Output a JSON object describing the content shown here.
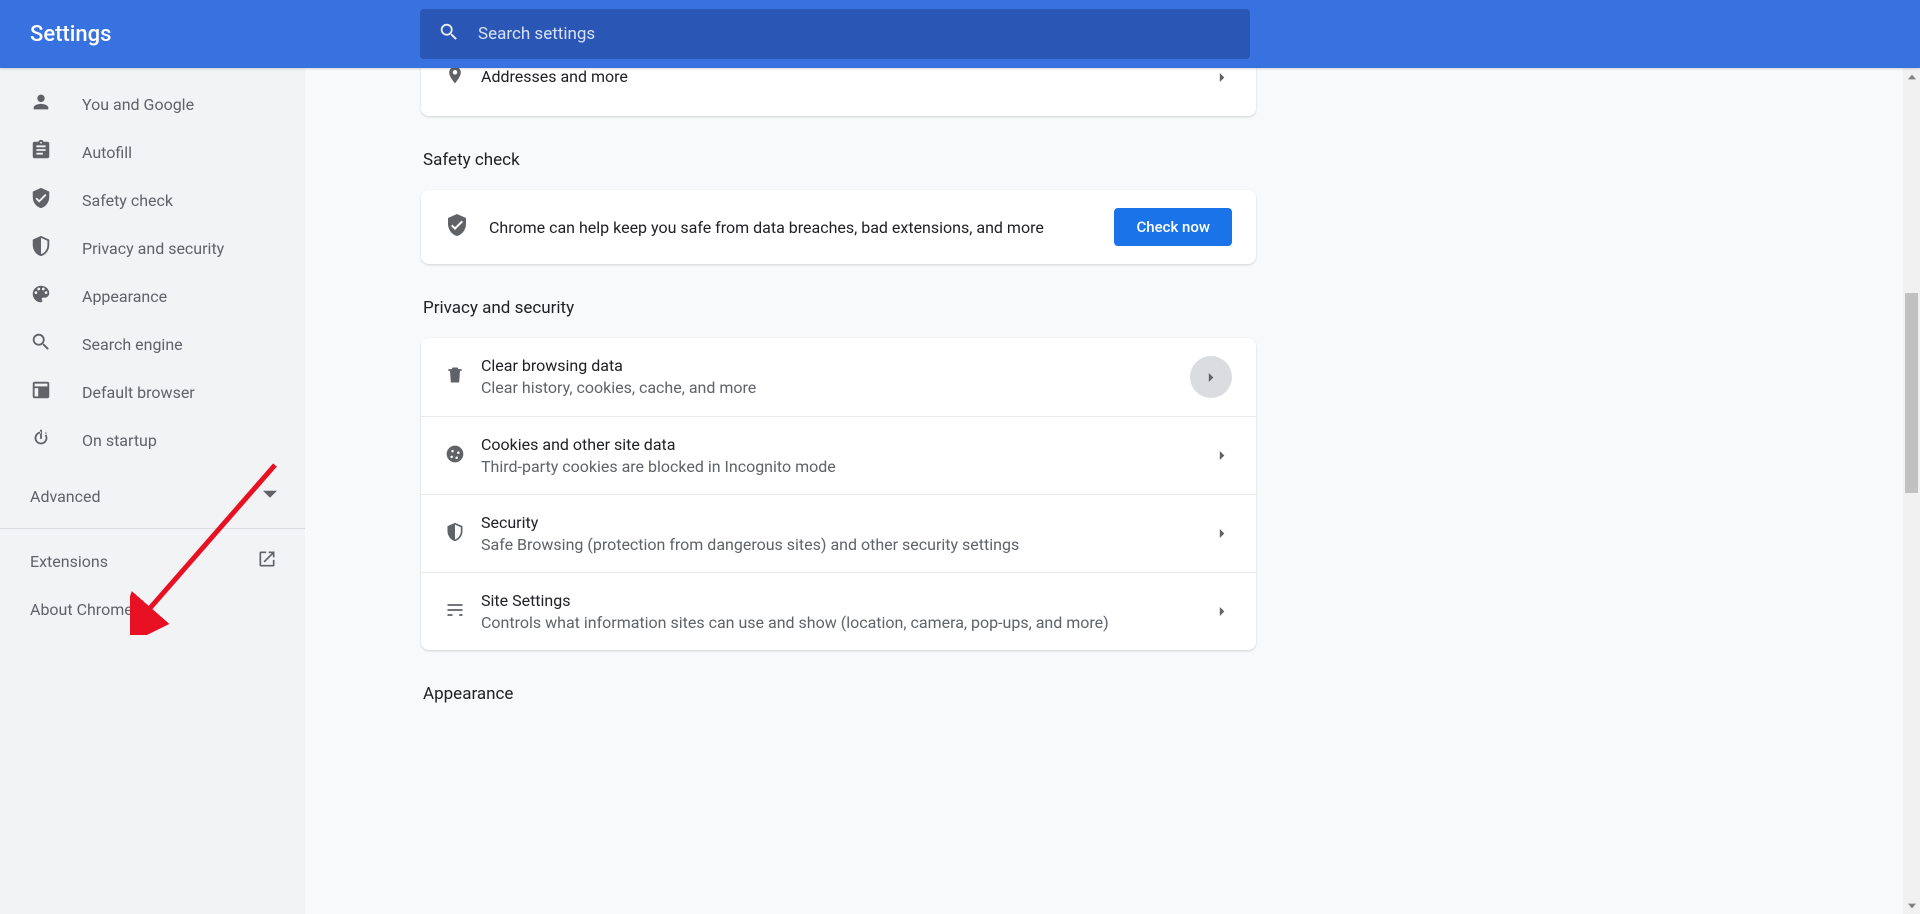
{
  "header": {
    "title": "Settings"
  },
  "search": {
    "placeholder": "Search settings"
  },
  "sidebar": {
    "items": [
      {
        "label": "You and Google",
        "icon": "person-icon"
      },
      {
        "label": "Autofill",
        "icon": "clipboard-icon"
      },
      {
        "label": "Safety check",
        "icon": "shield-check-icon"
      },
      {
        "label": "Privacy and security",
        "icon": "shield-icon"
      },
      {
        "label": "Appearance",
        "icon": "palette-icon"
      },
      {
        "label": "Search engine",
        "icon": "search-icon"
      },
      {
        "label": "Default browser",
        "icon": "browser-icon"
      },
      {
        "label": "On startup",
        "icon": "power-icon"
      }
    ],
    "advanced_label": "Advanced",
    "extensions_label": "Extensions",
    "about_label": "About Chrome"
  },
  "cut_row": {
    "title": "Addresses and more"
  },
  "safety": {
    "section_title": "Safety check",
    "text": "Chrome can help keep you safe from data breaches, bad extensions, and more",
    "button_label": "Check now"
  },
  "privacy": {
    "section_title": "Privacy and security",
    "items": [
      {
        "title": "Clear browsing data",
        "sub": "Clear history, cookies, cache, and more",
        "highlight": true
      },
      {
        "title": "Cookies and other site data",
        "sub": "Third-party cookies are blocked in Incognito mode"
      },
      {
        "title": "Security",
        "sub": "Safe Browsing (protection from dangerous sites) and other security settings"
      },
      {
        "title": "Site Settings",
        "sub": "Controls what information sites can use and show (location, camera, pop-ups, and more)"
      }
    ]
  },
  "appearance": {
    "section_title": "Appearance"
  }
}
